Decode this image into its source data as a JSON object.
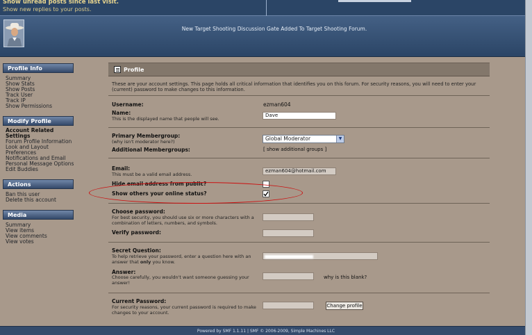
{
  "header": {
    "unread_link": "Show unread posts since last visit.",
    "replies_link": "Show new replies to your posts.",
    "news": "New Target Shooting Discussion Gate Added To Target Shooting Forum."
  },
  "sidebar": {
    "profile_info": {
      "title": "Profile Info",
      "items": [
        "Summary",
        "Show Stats",
        "Show Posts",
        "Track User",
        "Track IP",
        "Show Permissions"
      ]
    },
    "modify_profile": {
      "title": "Modify Profile",
      "active": "Account Related Settings",
      "items": [
        "Forum Profile Information",
        "Look and Layout Preferences",
        "Notifications and Email",
        "Personal Message Options",
        "Edit Buddies"
      ]
    },
    "actions": {
      "title": "Actions",
      "items": [
        "Ban this user",
        "Delete this account"
      ]
    },
    "media": {
      "title": "Media",
      "items": [
        "Summary",
        "View items",
        "View comments",
        "View votes"
      ]
    }
  },
  "profile": {
    "title": "Profile",
    "intro": "These are your account settings. This page holds all critical information that identifies you on this forum. For security reasons, you will need to enter your (current) password to make changes to this information.",
    "username_label": "Username:",
    "username_value": "ezman604",
    "name_label": "Name:",
    "name_sub": "This is the displayed name that people will see.",
    "name_value": "Dave",
    "membergroup_label": "Primary Membergroup:",
    "membergroup_sub": "(why isn't moderator here?)",
    "membergroup_value": "Global Moderator",
    "additional_label": "Additional Membergroups:",
    "additional_link": "[ show additional groups ]",
    "email_label": "Email:",
    "email_sub": "This must be a valid email address.",
    "email_value": "ezman604@hotmail.com",
    "hide_email_label": "Hide email address from public?",
    "hide_email_checked": false,
    "online_label": "Show others your online status?",
    "online_checked": true,
    "choose_pw_label": "Choose password:",
    "choose_pw_sub": "For best security, you should use six or more characters with a combination of letters, numbers, and symbols.",
    "verify_pw_label": "Verify password:",
    "secret_label": "Secret Question:",
    "secret_sub_1": "To help retrieve your password, enter a question here with an answer that",
    "secret_sub_only": "only",
    "secret_sub_2": "you know.",
    "answer_label": "Answer:",
    "answer_sub": "Choose carefully, you wouldn't want someone guessing your answer!",
    "why_blank": "why is this blank?",
    "current_pw_label": "Current Password:",
    "current_pw_sub": "For security reasons, your current password is required to make changes to your account.",
    "change_button": "Change profile"
  },
  "footer": {
    "text": "Powered by SMF 1.1.11 | SMF © 2006-2009, Simple Machines LLC"
  },
  "colors": {
    "page_bg": "#a8998b",
    "header_bg": "#2b4566",
    "annotation": "#cc1010"
  }
}
